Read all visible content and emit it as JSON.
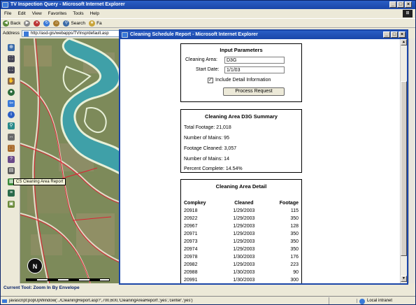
{
  "main": {
    "title": "TV Inspection Query - Microsoft Internet Explorer",
    "menu": [
      "File",
      "Edit",
      "View",
      "Favorites",
      "Tools",
      "Help"
    ],
    "toolbar": {
      "back": "Back",
      "search": "Search",
      "fav": "Fa"
    },
    "address_label": "Address",
    "address_value": "http://asd-gis/webapps/TVInsp/default.asp",
    "tooltip": "CS Cleaning Area Report",
    "current_tool": "Current Tool: Zoom In By Envelope",
    "status_url": "javascript:popUpWindow('../CleaningReport.asp?',700,600,'CleaningAreaReport','yes','center','yes')",
    "zone": "Local intranet",
    "north": "N"
  },
  "popup": {
    "title": "Cleaning Schedule Report - Microsoft Internet Explorer",
    "params": {
      "title": "Input Parameters",
      "area_label": "Cleaning Area:",
      "area_value": "D3G",
      "date_label": "Start Date:",
      "date_value": "1/1/03",
      "detail_label": "Include Detail Information",
      "detail_checked": "✓",
      "process_label": "Process Request"
    },
    "summary": {
      "title": "Cleaning Area D3G Summary",
      "lines": [
        "Total Footage: 21,018",
        "Number of Mains: 95",
        "Footage Cleaned: 3,057",
        "Number of Mains: 14",
        "Percent Complete: 14.54%"
      ]
    },
    "detail": {
      "title": "Cleaning Area Detail",
      "headers": [
        "Compkey",
        "Cleaned",
        "Footage"
      ],
      "rows": [
        [
          "20918",
          "1/29/2003",
          "115"
        ],
        [
          "20922",
          "1/29/2003",
          "350"
        ],
        [
          "20967",
          "1/29/2003",
          "128"
        ],
        [
          "20971",
          "1/29/2003",
          "350"
        ],
        [
          "20973",
          "1/29/2003",
          "350"
        ],
        [
          "20974",
          "1/29/2003",
          "350"
        ],
        [
          "20978",
          "1/30/2003",
          "176"
        ],
        [
          "20982",
          "1/29/2003",
          "223"
        ],
        [
          "20988",
          "1/30/2003",
          "90"
        ],
        [
          "20991",
          "1/30/2003",
          "300"
        ]
      ]
    }
  }
}
